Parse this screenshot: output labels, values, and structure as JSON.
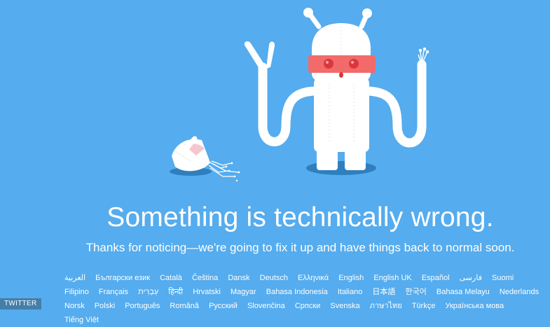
{
  "page": {
    "headline": "Something is technically wrong.",
    "subline": "Thanks for noticing—we're going to fix it up and have things back to normal soon."
  },
  "colors": {
    "background": "#55acee",
    "robot_body": "#ffffff",
    "robot_mask": "#f26a6a",
    "robot_eye": "#d8383c",
    "shadow": "#2f7fbe"
  },
  "languages": [
    "العربية",
    "Български език",
    "Català",
    "Čeština",
    "Dansk",
    "Deutsch",
    "Ελληνικά",
    "English",
    "English UK",
    "Español",
    "فارسی",
    "Suomi",
    "Filipino",
    "Français",
    "עִבְרִית",
    "हिन्दी",
    "Hrvatski",
    "Magyar",
    "Bahasa Indonesia",
    "Italiano",
    "日本語",
    "한국어",
    "Bahasa Melayu",
    "Nederlands",
    "Norsk",
    "Polski",
    "Português",
    "Română",
    "Русский",
    "Slovenčina",
    "Српски",
    "Svenska",
    "ภาษาไทย",
    "Türkçe",
    "Українська мова",
    "Tiếng Việt"
  ],
  "watermark": "TWITTER"
}
